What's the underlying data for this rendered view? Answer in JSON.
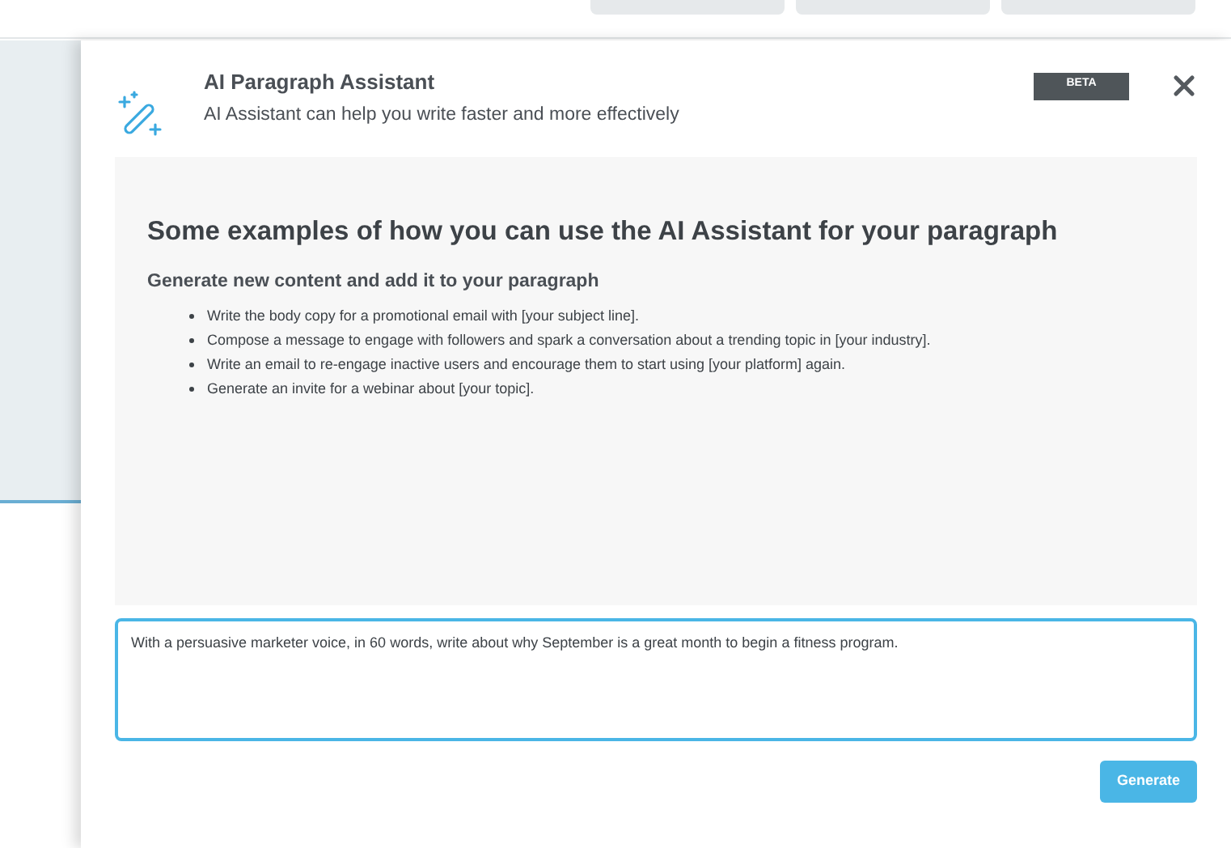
{
  "panel": {
    "title": "AI Paragraph Assistant",
    "subtitle": "AI Assistant can help you write faster and more effectively",
    "badge": "BETA"
  },
  "examples": {
    "heading": "Some examples of how you can use the AI Assistant for your paragraph",
    "subheading": "Generate new content and add it to your paragraph",
    "items": [
      "Write the body copy for a promotional email with [your subject line].",
      "Compose a message to engage with followers and spark a conversation about a trending topic in [your industry].",
      "Write an email to re-engage inactive users and encourage them to start using [your platform] again.",
      "Generate an invite for a webinar about [your topic]."
    ]
  },
  "prompt": {
    "value": "With a persuasive marketer voice, in 60 words, write about why September is a great month to begin a fitness program."
  },
  "buttons": [
    "Generate"
  ]
}
